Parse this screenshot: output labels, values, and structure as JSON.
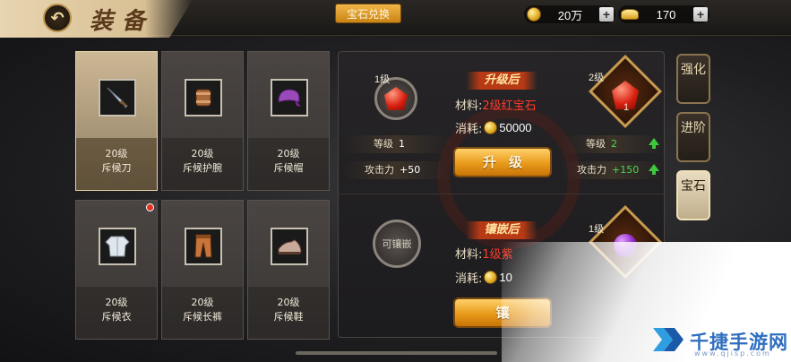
{
  "header": {
    "back_icon": "back-arrow-icon",
    "title": "装备",
    "exchange_label": "宝石兑换",
    "gold": {
      "icon": "gold-coin-icon",
      "value": "20万"
    },
    "ingot": {
      "icon": "gold-ingot-icon",
      "value": "170"
    }
  },
  "equipment": [
    {
      "level": "20级",
      "name": "斥候刀",
      "icon": "sword-icon",
      "selected": true,
      "red_dot": false
    },
    {
      "level": "20级",
      "name": "斥候护腕",
      "icon": "bracer-icon",
      "selected": false,
      "red_dot": false
    },
    {
      "level": "20级",
      "name": "斥候帽",
      "icon": "hat-icon",
      "selected": false,
      "red_dot": false
    },
    {
      "level": "20级",
      "name": "斥候衣",
      "icon": "armor-icon",
      "selected": false,
      "red_dot": true
    },
    {
      "level": "20级",
      "name": "斥候长裤",
      "icon": "pants-icon",
      "selected": false,
      "red_dot": false
    },
    {
      "level": "20级",
      "name": "斥候鞋",
      "icon": "boots-icon",
      "selected": false,
      "red_dot": false
    }
  ],
  "upgrade": {
    "current_gem_level": "1级",
    "ribbon": "升级后",
    "material_label": "材料:",
    "material_value": "2级红宝石",
    "cost_label": "消耗:",
    "cost_value": "50000",
    "next_gem_level": "2级",
    "next_gem_count": "1",
    "level_label_left": "等级",
    "level_value_left": "1",
    "level_label_right": "等级",
    "level_value_right": "2",
    "attack_label_left": "攻击力",
    "attack_value_left": "+50",
    "attack_label_right": "攻击力",
    "attack_value_right": "+150",
    "button_label": "升级"
  },
  "inlay": {
    "socket_label": "可镶嵌",
    "ribbon": "镶嵌后",
    "material_label": "材料:",
    "material_value": "1级紫",
    "cost_label": "消耗:",
    "cost_value": "10",
    "gem_level": "1级",
    "button_label": "镶"
  },
  "side_tabs": [
    {
      "label": "强化",
      "active": false
    },
    {
      "label": "进阶",
      "active": false
    },
    {
      "label": "宝石",
      "active": true
    }
  ],
  "watermark": {
    "text": "千捷手游网",
    "sub": "www.qjisp.com"
  },
  "colors": {
    "accent_gold": "#e89a1a",
    "highlight_red": "#ff3a2a",
    "stat_green": "#4cd84c"
  }
}
